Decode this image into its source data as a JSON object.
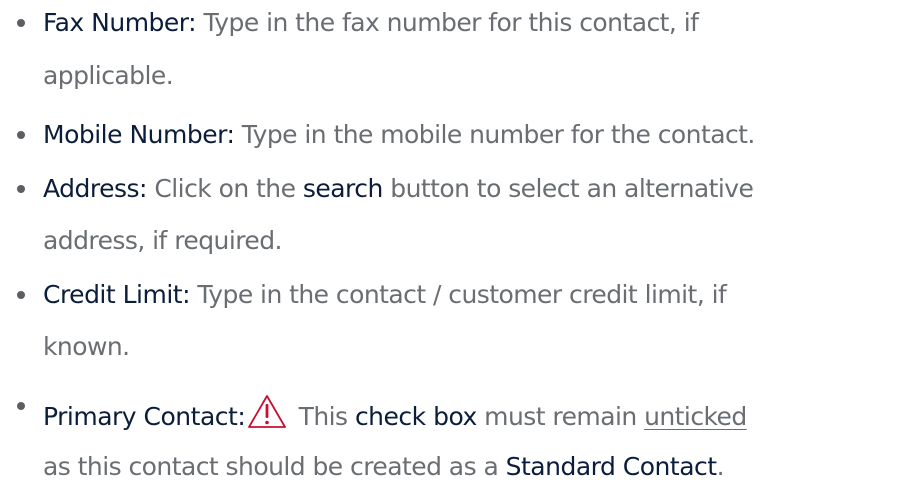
{
  "items": [
    {
      "term": "Fax Number:",
      "line1": " Type in the fax number for this contact, if",
      "line2": "applicable."
    },
    {
      "term": "Mobile Number:",
      "line1": " Type in the mobile number for the contact."
    },
    {
      "term": "Address:",
      "pre": " Click on the ",
      "em": "search",
      "post": " button to select an alternative",
      "line2": "address, if required."
    },
    {
      "term": "Credit Limit:",
      "line1": " Type in the contact / customer credit limit, if",
      "line2": "known."
    },
    {
      "term": "Primary Contact:",
      "pre": " This ",
      "em1": "check box",
      "mid": " must remain ",
      "underlined": "unticked",
      "line2_pre": "as this contact should be created as a ",
      "em2": "Standard Contact",
      "line2_post": "."
    }
  ],
  "colors": {
    "term": "#0c1d3b",
    "body": "#6a6e72",
    "warning": "#c8102e"
  },
  "icons": {
    "warning": "warning-triangle-icon"
  }
}
